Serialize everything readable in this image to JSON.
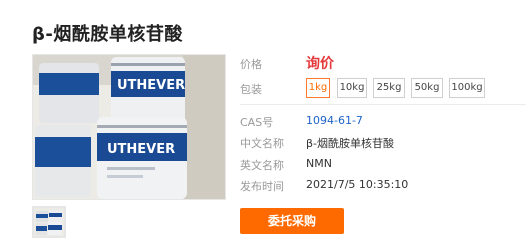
{
  "product": {
    "title": "β-烟酰胺单核苷酸"
  },
  "image": {
    "brand_text": "UTHEVER",
    "brand_text_2": "UTHEVER"
  },
  "details": {
    "price_label": "价格",
    "price_value": "询价",
    "pack_label": "包装",
    "pack_options": [
      "1kg",
      "10kg",
      "25kg",
      "50kg",
      "100kg"
    ],
    "selected_pack": "1kg",
    "cas_label": "CAS号",
    "cas_value": "1094-61-7",
    "cn_name_label": "中文名称",
    "cn_name_value": "β-烟酰胺单核苷酸",
    "en_name_label": "英文名称",
    "en_name_value": "NMN",
    "date_label": "发布时间",
    "date_value": "2021/7/5 10:35:10"
  },
  "actions": {
    "buy_label": "委托采购"
  },
  "colors": {
    "price": "#e4393c",
    "accent": "#ff6a00",
    "link": "#1e63c8"
  }
}
